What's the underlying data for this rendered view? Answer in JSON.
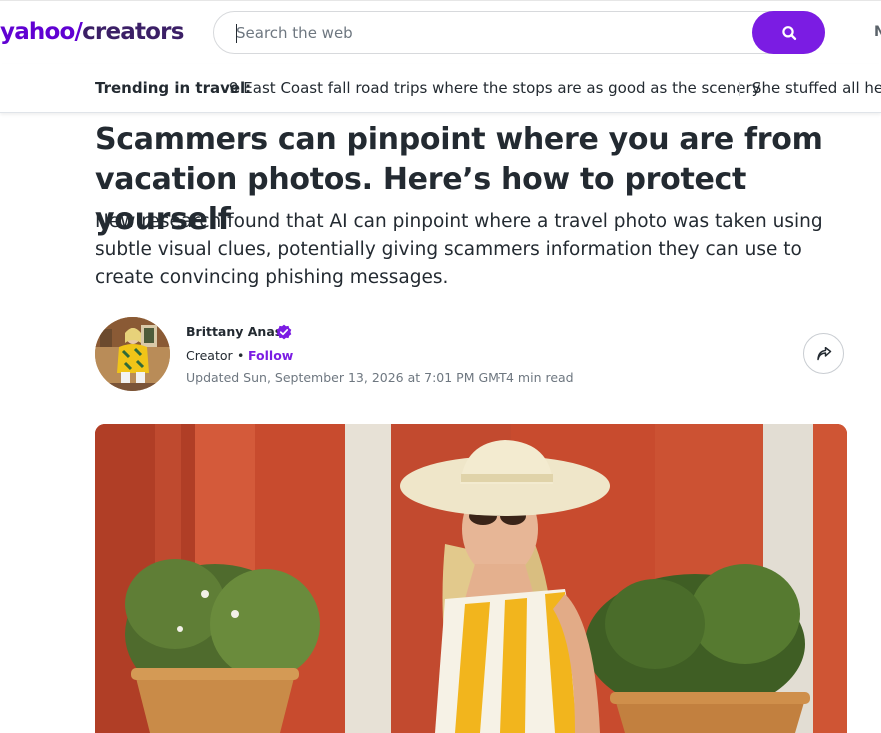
{
  "header": {
    "logo_brand": "yahoo/",
    "logo_product": "creators",
    "search_placeholder": "Search the web",
    "right_cut_text": "N"
  },
  "trending": {
    "label": "Trending in travel:",
    "items": [
      "9 East Coast fall road trips where the stops are as good as the scenery",
      "She stuffed all her"
    ]
  },
  "article": {
    "title": "Scammers can pinpoint where you are from vacation photos. Here’s how to protect yourself",
    "summary": "New research found that AI can pinpoint where a travel photo was taken using subtle visual clues, potentially giving scammers information they can use to create convincing phishing messages.",
    "author": {
      "name": "Brittany Anas",
      "role": "Creator",
      "separator": "•",
      "follow_label": "Follow"
    },
    "updated": "Updated Sun, September 13, 2026 at 7:01 PM GMT",
    "meta_separator": "·",
    "read_time": "4 min read"
  },
  "colors": {
    "brand_purple": "#6001d2",
    "button_purple": "#7b1ce3",
    "text_dark": "#232a31",
    "text_muted": "#6e7780"
  },
  "icons": {
    "search": "search-icon",
    "verified": "verified-badge-icon",
    "share": "share-arrow-icon"
  }
}
